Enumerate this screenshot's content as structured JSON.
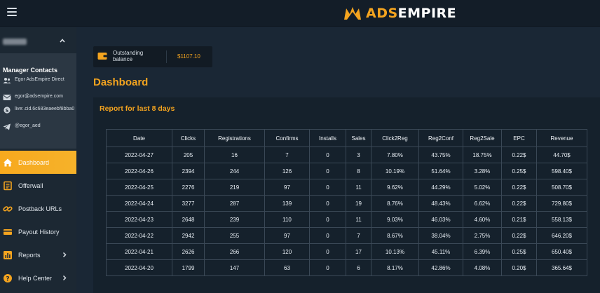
{
  "header": {
    "logo_prefix": "ADS",
    "logo_suffix": "EMPIRE"
  },
  "sidebar": {
    "contacts": {
      "title": "Manager Contacts",
      "name": "Egor AdsEmpire Direct",
      "email": "egor@adsempire.com",
      "skype": "live:.cid.6c683eaeebf8bba0",
      "telegram": "@egor_aed"
    },
    "nav": [
      {
        "label": "Dashboard",
        "icon": "home-icon"
      },
      {
        "label": "Offerwall",
        "icon": "offerwall-icon"
      },
      {
        "label": "Postback URLs",
        "icon": "link-icon"
      },
      {
        "label": "Payout History",
        "icon": "payout-icon"
      },
      {
        "label": "Reports",
        "icon": "bar-chart-icon"
      },
      {
        "label": "Help Center",
        "icon": "help-icon"
      }
    ]
  },
  "balance": {
    "label": "Outstanding balance",
    "value": "$1107.10"
  },
  "page": {
    "title": "Dashboard",
    "report_title": "Report for last 8 days"
  },
  "table": {
    "headers": [
      "Date",
      "Clicks",
      "Registrations",
      "Confirms",
      "Installs",
      "Sales",
      "Click2Reg",
      "Reg2Conf",
      "Reg2Sale",
      "EPC",
      "Revenue"
    ],
    "rows": [
      [
        "2022-04-27",
        "205",
        "16",
        "7",
        "0",
        "3",
        "7.80%",
        "43.75%",
        "18.75%",
        "0.22$",
        "44.70$"
      ],
      [
        "2022-04-26",
        "2394",
        "244",
        "126",
        "0",
        "8",
        "10.19%",
        "51.64%",
        "3.28%",
        "0.25$",
        "598.40$"
      ],
      [
        "2022-04-25",
        "2276",
        "219",
        "97",
        "0",
        "11",
        "9.62%",
        "44.29%",
        "5.02%",
        "0.22$",
        "508.70$"
      ],
      [
        "2022-04-24",
        "3277",
        "287",
        "139",
        "0",
        "19",
        "8.76%",
        "48.43%",
        "6.62%",
        "0.22$",
        "729.80$"
      ],
      [
        "2022-04-23",
        "2648",
        "239",
        "110",
        "0",
        "11",
        "9.03%",
        "46.03%",
        "4.60%",
        "0.21$",
        "558.13$"
      ],
      [
        "2022-04-22",
        "2942",
        "255",
        "97",
        "0",
        "7",
        "8.67%",
        "38.04%",
        "2.75%",
        "0.22$",
        "646.20$"
      ],
      [
        "2022-04-21",
        "2626",
        "266",
        "120",
        "0",
        "17",
        "10.13%",
        "45.11%",
        "6.39%",
        "0.25$",
        "650.40$"
      ],
      [
        "2022-04-20",
        "1799",
        "147",
        "63",
        "0",
        "6",
        "8.17%",
        "42.86%",
        "4.08%",
        "0.20$",
        "365.64$"
      ]
    ]
  },
  "colors": {
    "accent": "#f4a41f",
    "background": "#1a2735",
    "panel": "#15212c",
    "sidebar_active": "#f7a91e"
  }
}
